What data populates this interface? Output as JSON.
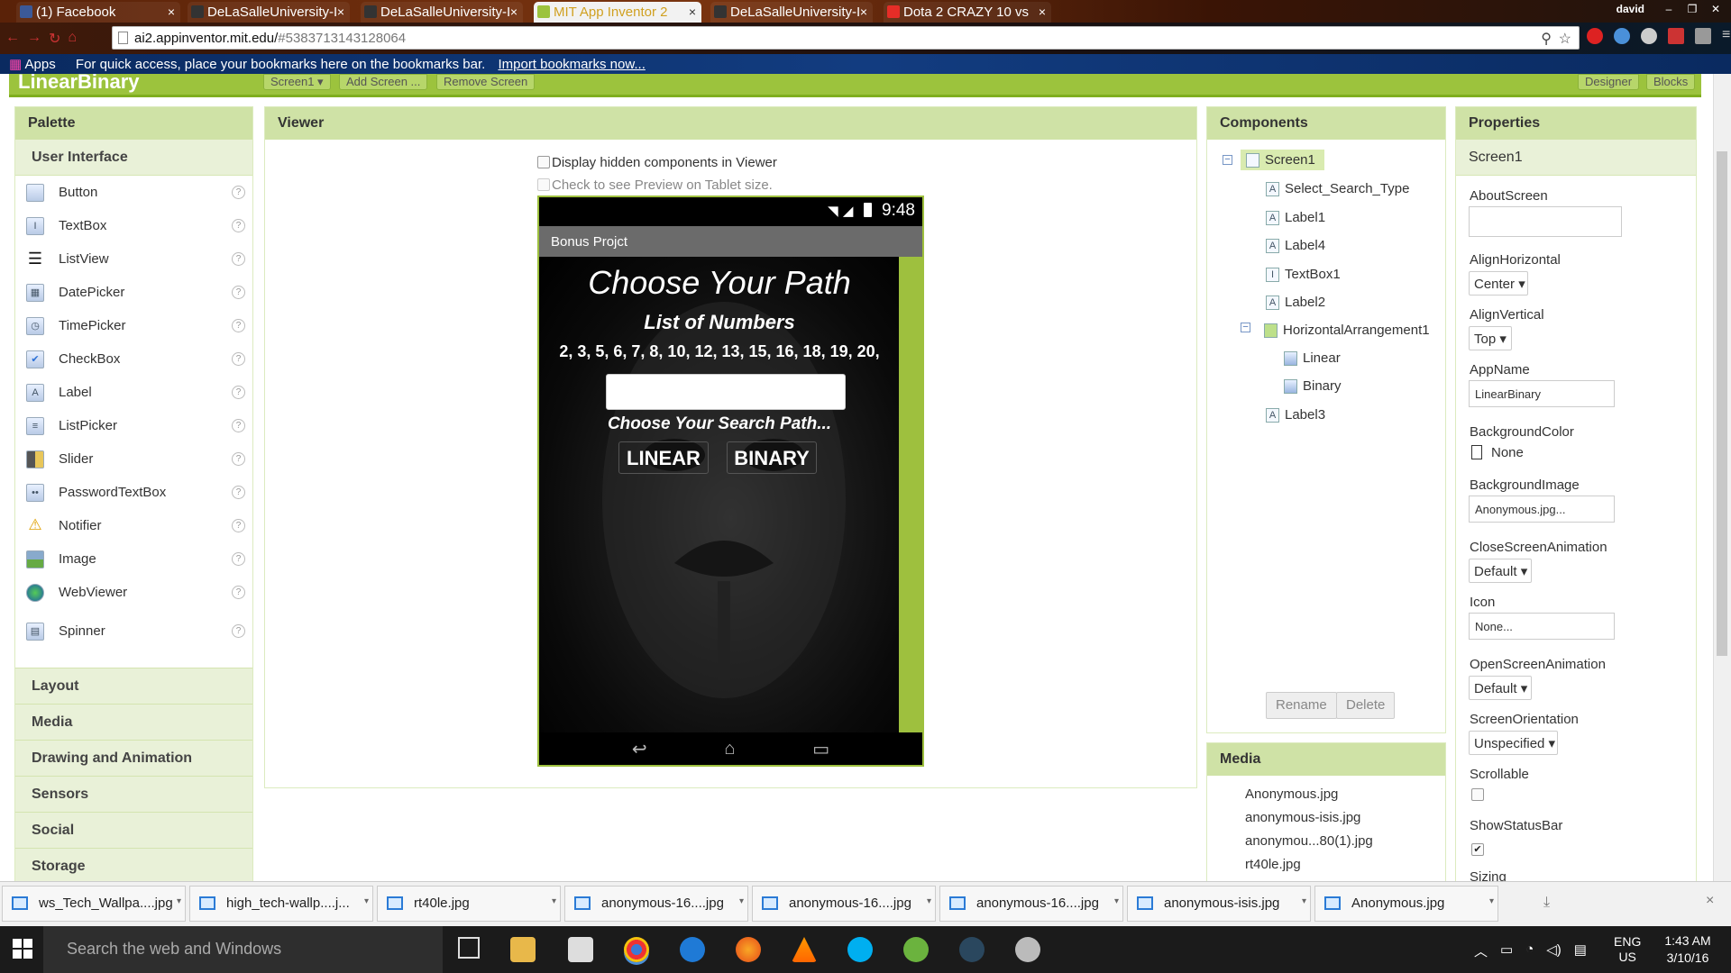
{
  "browser": {
    "tabs": [
      {
        "label": "(1) Facebook",
        "active": false
      },
      {
        "label": "DeLaSalleUniversity-I",
        "active": false
      },
      {
        "label": "DeLaSalleUniversity-I",
        "active": false
      },
      {
        "label": "MIT App Inventor 2",
        "active": true
      },
      {
        "label": "DeLaSalleUniversity-I",
        "active": false
      },
      {
        "label": "Dota 2 CRAZY 10 vs",
        "active": false
      }
    ],
    "user": "david",
    "url_host": "ai2.appinventor.mit.edu/",
    "url_hash": "#5383713143128064",
    "bookmarks_apps": "Apps",
    "bookmarks_prompt": "For quick access, place your bookmarks here on the bookmarks bar.",
    "bookmarks_link": "Import bookmarks now..."
  },
  "app_header": {
    "project_name": "LinearBinary",
    "screen_dropdown": "Screen1 ▾",
    "add_screen": "Add Screen ...",
    "remove_screen": "Remove Screen",
    "designer": "Designer",
    "blocks": "Blocks"
  },
  "palette": {
    "title": "Palette",
    "user_interface": "User Interface",
    "items": [
      {
        "label": "Button",
        "icon": "button-icon"
      },
      {
        "label": "TextBox",
        "icon": "textbox-icon"
      },
      {
        "label": "ListView",
        "icon": "listview-icon"
      },
      {
        "label": "DatePicker",
        "icon": "datepicker-icon"
      },
      {
        "label": "TimePicker",
        "icon": "timepicker-icon"
      },
      {
        "label": "CheckBox",
        "icon": "checkbox-icon"
      },
      {
        "label": "Label",
        "icon": "label-icon"
      },
      {
        "label": "ListPicker",
        "icon": "listpicker-icon"
      },
      {
        "label": "Slider",
        "icon": "slider-icon"
      },
      {
        "label": "PasswordTextBox",
        "icon": "passwordtextbox-icon"
      },
      {
        "label": "Notifier",
        "icon": "notifier-icon"
      },
      {
        "label": "Image",
        "icon": "image-icon"
      },
      {
        "label": "WebViewer",
        "icon": "webviewer-icon"
      },
      {
        "label": "Spinner",
        "icon": "spinner-icon"
      }
    ],
    "categories": [
      "Layout",
      "Media",
      "Drawing and Animation",
      "Sensors",
      "Social",
      "Storage"
    ]
  },
  "viewer": {
    "title": "Viewer",
    "hidden_components": "Display hidden components in Viewer",
    "tablet_preview": "Check to see Preview on Tablet size.",
    "phone": {
      "time": "9:48",
      "app_title": "Bonus Projct",
      "heading": "Choose Your Path",
      "list_title": "List of Numbers",
      "numbers": "2, 3, 5, 6, 7, 8, 10, 12, 13, 15, 16, 18, 19, 20,",
      "search_prompt": "Choose Your Search Path...",
      "linear_button": "LINEAR",
      "binary_button": "BINARY"
    }
  },
  "components": {
    "title": "Components",
    "tree": [
      {
        "label": "Screen1",
        "level": 0,
        "icon": "screen-icon"
      },
      {
        "label": "Select_Search_Type",
        "level": 1,
        "icon": "label-icon"
      },
      {
        "label": "Label1",
        "level": 1,
        "icon": "label-icon"
      },
      {
        "label": "Label4",
        "level": 1,
        "icon": "label-icon"
      },
      {
        "label": "TextBox1",
        "level": 1,
        "icon": "textbox-icon"
      },
      {
        "label": "Label2",
        "level": 1,
        "icon": "label-icon"
      },
      {
        "label": "HorizontalArrangement1",
        "level": 1,
        "icon": "horizontal-arrangement-icon"
      },
      {
        "label": "Linear",
        "level": 2,
        "icon": "button-icon"
      },
      {
        "label": "Binary",
        "level": 2,
        "icon": "button-icon"
      },
      {
        "label": "Label3",
        "level": 1,
        "icon": "label-icon"
      }
    ],
    "rename": "Rename",
    "delete": "Delete"
  },
  "media": {
    "title": "Media",
    "files": [
      "Anonymous.jpg",
      "anonymous-isis.jpg",
      "anonymou...80(1).jpg",
      "rt40le.jpg"
    ]
  },
  "properties": {
    "title": "Properties",
    "component": "Screen1",
    "about_screen_label": "AboutScreen",
    "about_screen_value": "",
    "align_horizontal_label": "AlignHorizontal",
    "align_horizontal_value": "Center ▾",
    "align_vertical_label": "AlignVertical",
    "align_vertical_value": "Top ▾",
    "app_name_label": "AppName",
    "app_name_value": "LinearBinary",
    "background_color_label": "BackgroundColor",
    "background_color_value": "None",
    "background_image_label": "BackgroundImage",
    "background_image_value": "Anonymous.jpg...",
    "close_screen_animation_label": "CloseScreenAnimation",
    "close_screen_animation_value": "Default ▾",
    "icon_label": "Icon",
    "icon_value": "None...",
    "open_screen_animation_label": "OpenScreenAnimation",
    "open_screen_animation_value": "Default ▾",
    "screen_orientation_label": "ScreenOrientation",
    "screen_orientation_value": "Unspecified ▾",
    "scrollable_label": "Scrollable",
    "scrollable_checked": false,
    "show_status_bar_label": "ShowStatusBar",
    "show_status_bar_checked": true,
    "sizing_label": "Sizing"
  },
  "downloads": [
    "ws_Tech_Wallpa....jpg",
    "high_tech-wallp....j...",
    "rt40le.jpg",
    "anonymous-16....jpg",
    "anonymous-16....jpg",
    "anonymous-16....jpg",
    "anonymous-isis.jpg",
    "Anonymous.jpg"
  ],
  "taskbar": {
    "search_placeholder": "Search the web and Windows",
    "lang": "ENG",
    "region": "US",
    "time": "1:43 AM",
    "date": "3/10/16"
  },
  "colors": {
    "accent_green": "#9cc33d",
    "panel_header": "#cfe2a6",
    "active_tab_text": "#d0a020"
  }
}
